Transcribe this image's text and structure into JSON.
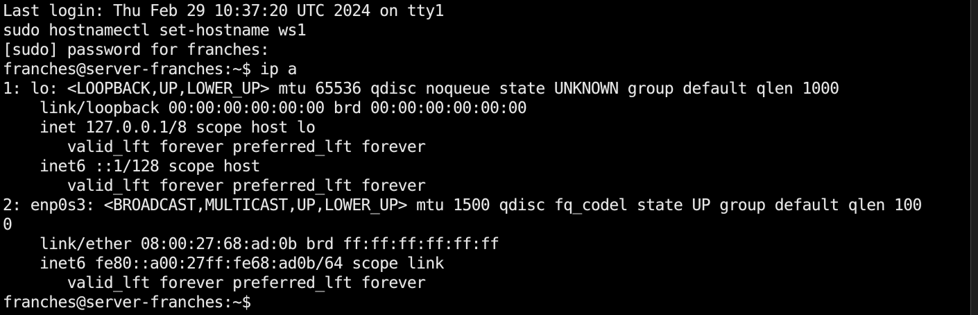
{
  "terminal": {
    "lines": [
      "Last login: Thu Feb 29 10:37:20 UTC 2024 on tty1",
      "sudo hostnamectl set-hostname ws1",
      "[sudo] password for franches:",
      "franches@server-franches:~$ ip a",
      "1: lo: <LOOPBACK,UP,LOWER_UP> mtu 65536 qdisc noqueue state UNKNOWN group default qlen 1000",
      "    link/loopback 00:00:00:00:00:00 brd 00:00:00:00:00:00",
      "    inet 127.0.0.1/8 scope host lo",
      "       valid_lft forever preferred_lft forever",
      "    inet6 ::1/128 scope host",
      "       valid_lft forever preferred_lft forever",
      "2: enp0s3: <BROADCAST,MULTICAST,UP,LOWER_UP> mtu 1500 qdisc fq_codel state UP group default qlen 100",
      "0",
      "    link/ether 08:00:27:68:ad:0b brd ff:ff:ff:ff:ff:ff",
      "    inet6 fe80::a00:27ff:fe68:ad0b/64 scope link",
      "       valid_lft forever preferred_lft forever",
      "franches@server-franches:~$"
    ],
    "colors": {
      "background": "#000000",
      "text": "#e8e8e8"
    }
  }
}
